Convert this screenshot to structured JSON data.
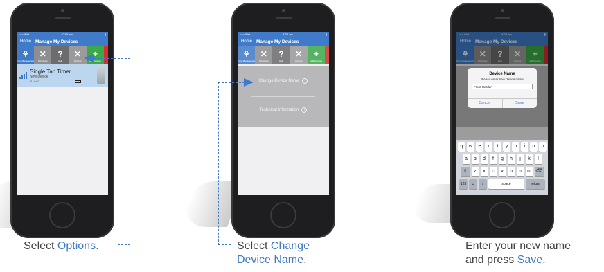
{
  "step1": {
    "status_left": "••••◦ iNet",
    "status_time": "10:55 am",
    "nav_home": "Home",
    "nav_title": "Manage My Devices",
    "toolbar": [
      {
        "glyph": "⚘",
        "label": "Zone Management",
        "color": "blue"
      },
      {
        "glyph": "✕",
        "label": "Schedules",
        "color": "gray1"
      },
      {
        "glyph": "?",
        "label": "Help",
        "color": "gray2"
      },
      {
        "glyph": "✕",
        "label": "Options",
        "color": "gray3"
      },
      {
        "glyph": "+",
        "label": "Add Devices",
        "color": "green"
      }
    ],
    "device_name": "Single Tap Timer",
    "device_status": "New Device",
    "device_id": "BTX1A",
    "caption_prefix": "Select ",
    "caption_highlight": "Options."
  },
  "step2": {
    "status_left": "••••◦ iNet",
    "status_time": "8:34 am",
    "nav_home": "Home",
    "nav_title": "Manage My Devices",
    "option_1": "Change Device Name",
    "option_2": "Technical Information",
    "caption_prefix": "Select ",
    "caption_highlight_1": "Change",
    "caption_highlight_2": "Device Name."
  },
  "step3": {
    "status_left": "••••◦ iNet",
    "status_time": "8:34 am",
    "nav_home": "Home",
    "nav_title": "Manage My Devices",
    "dialog_title": "Device Name",
    "dialog_message": "Please enter new device name",
    "dialog_value": "Front Garden",
    "dialog_cancel": "Cancel",
    "dialog_save": "Save",
    "keys_row1": [
      "q",
      "w",
      "e",
      "r",
      "t",
      "y",
      "u",
      "i",
      "o",
      "p"
    ],
    "keys_row2": [
      "a",
      "s",
      "d",
      "f",
      "g",
      "h",
      "j",
      "k",
      "l"
    ],
    "keys_row3": [
      "z",
      "x",
      "c",
      "v",
      "b",
      "n",
      "m"
    ],
    "key_shift": "⇧",
    "key_delete": "⌫",
    "key_123": "123",
    "key_emoji": "☺",
    "key_mic": "̸",
    "key_space": "space",
    "key_return": "return",
    "caption_line1": "Enter your new name",
    "caption_line2_prefix": "and press ",
    "caption_highlight": "Save."
  },
  "accent_color": "#3f7bc9"
}
